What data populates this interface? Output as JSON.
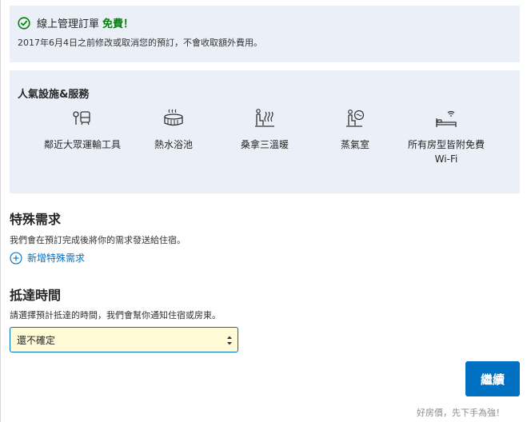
{
  "banner": {
    "title": "線上管理訂單",
    "free": "免費！",
    "note": "2017年6月4日之前修改或取消您的預訂，不會收取額外費用。"
  },
  "amenities": {
    "title": "人氣設施&服務",
    "items": [
      {
        "label": "鄰近大眾運輸工具",
        "icon": "public-transit-icon"
      },
      {
        "label": "熱水浴池",
        "icon": "hot-tub-icon"
      },
      {
        "label": "桑拿三溫暖",
        "icon": "sauna-icon"
      },
      {
        "label": "蒸氣室",
        "icon": "steam-room-icon"
      },
      {
        "label": "所有房型皆附免費Wi-Fi",
        "icon": "wifi-bed-icon"
      }
    ]
  },
  "special_requests": {
    "title": "特殊需求",
    "description": "我們會在預訂完成後將你的需求發送給住宿。",
    "add_link": "新增特殊需求"
  },
  "arrival": {
    "title": "抵達時間",
    "description": "請選擇預計抵達的時間，我們會幫你通知住宿或房東。",
    "selected": "還不確定"
  },
  "footer": {
    "continue_label": "繼續",
    "slogan": "好房價，先下手為強！"
  },
  "colors": {
    "accent": "#0071c2",
    "free": "#008009",
    "panel": "#ebf0f8",
    "select_bg": "#fffbd6"
  }
}
